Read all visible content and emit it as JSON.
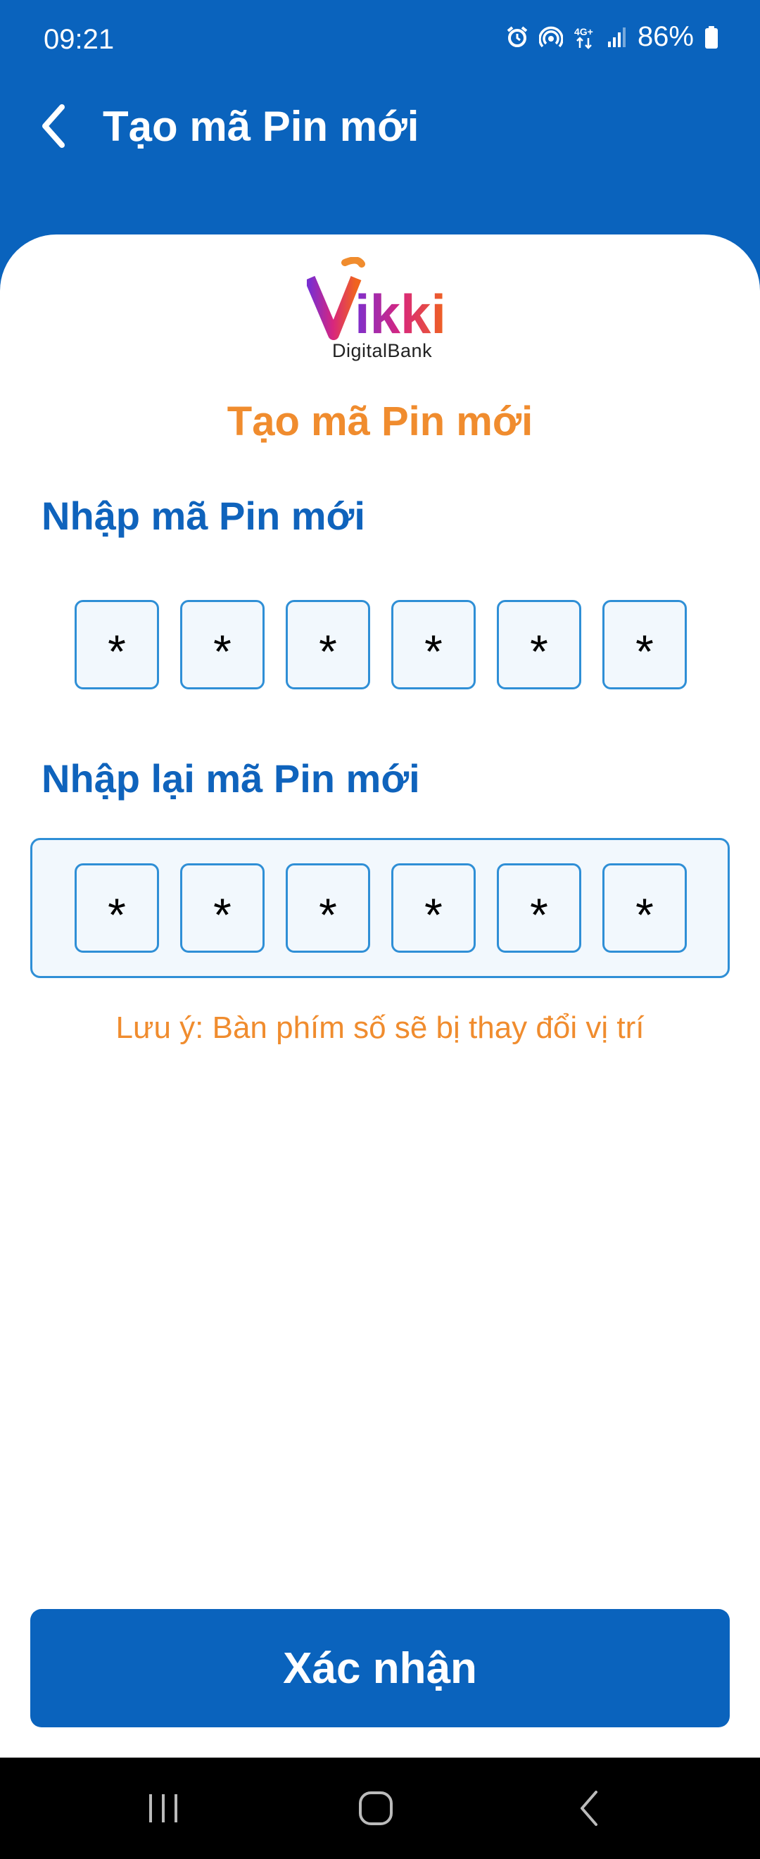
{
  "status_bar": {
    "time": "09:21",
    "battery_percent": "86%",
    "network": "4G+",
    "icons": [
      "alarm-icon",
      "hotspot-icon",
      "network-4g-icon",
      "signal-icon",
      "battery-icon"
    ]
  },
  "app_bar": {
    "title": "Tạo mã Pin mới",
    "back_icon": "chevron-left-icon"
  },
  "logo": {
    "name": "Vikki",
    "subtitle": "DigitalBank"
  },
  "screen": {
    "title": "Tạo mã Pin mới",
    "new_pin_label": "Nhập mã Pin mới",
    "confirm_pin_label": "Nhập lại mã Pin mới",
    "new_pin_digits": [
      "*",
      "*",
      "*",
      "*",
      "*",
      "*"
    ],
    "confirm_pin_digits": [
      "*",
      "*",
      "*",
      "*",
      "*",
      "*"
    ],
    "note": "Lưu ý: Bàn phím số sẽ bị thay đổi vị trí",
    "confirm_button": "Xác nhận"
  },
  "colors": {
    "primary": "#0a63bd",
    "accent_orange": "#f08c2e",
    "pin_border": "#2f8fd6",
    "pin_fill": "#f2f8fd"
  },
  "nav_bar": {
    "icons": [
      "recent-apps-icon",
      "home-icon",
      "back-icon"
    ]
  }
}
